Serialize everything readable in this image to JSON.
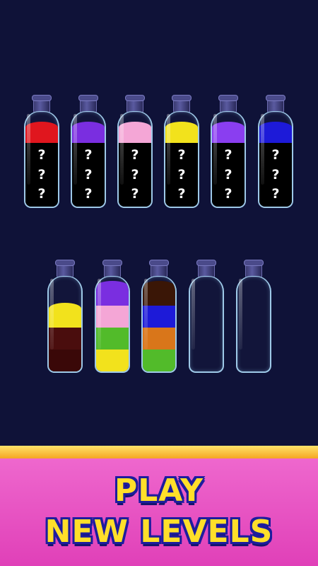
{
  "colors": {
    "background": "#0f1238",
    "banner": "#e040b8",
    "banner_stripe": "#f5a623",
    "text_fill": "#ffdf2a",
    "text_outline": "#1d1d9e"
  },
  "bottles_row1": [
    {
      "top_color": "#e0161e",
      "top_name": "red",
      "hidden": [
        "?",
        "?",
        "?"
      ]
    },
    {
      "top_color": "#7a2ee0",
      "top_name": "purple",
      "hidden": [
        "?",
        "?",
        "?"
      ]
    },
    {
      "top_color": "#f4a6d6",
      "top_name": "pink",
      "hidden": [
        "?",
        "?",
        "?"
      ]
    },
    {
      "top_color": "#f2e21c",
      "top_name": "yellow",
      "hidden": [
        "?",
        "?",
        "?"
      ]
    },
    {
      "top_color": "#8a3ef0",
      "top_name": "violet",
      "hidden": [
        "?",
        "?",
        "?"
      ]
    },
    {
      "top_color": "#1d1ad8",
      "top_name": "blue",
      "hidden": [
        "?",
        "?",
        "?"
      ]
    }
  ],
  "bottles_row2": [
    {
      "layers": [
        "#f2e21c",
        "#4a0d0d",
        "#3a0808"
      ]
    },
    {
      "layers": [
        "#7a2ee0",
        "#f4a6d6",
        "#52bb2a",
        "#f2e21c"
      ]
    },
    {
      "layers": [
        "#3a1606",
        "#1d1ad8",
        "#d9761a",
        "#52bb2a"
      ]
    },
    {
      "layers": []
    },
    {
      "layers": []
    }
  ],
  "banner": {
    "line1": "PLAY",
    "line2": "NEW LEVELS"
  }
}
